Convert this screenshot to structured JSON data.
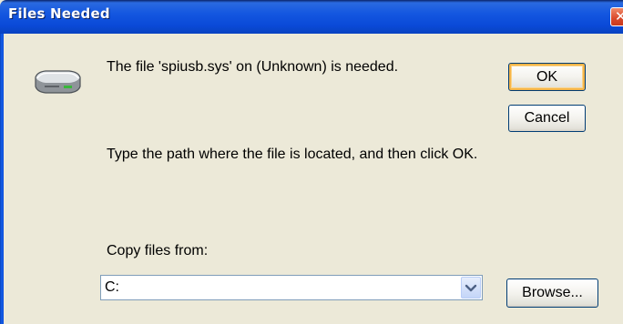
{
  "window": {
    "title": "Files Needed"
  },
  "titlebar": {
    "close_glyph": "✕"
  },
  "message": {
    "text": "The file 'spiusb.sys' on (Unknown) is needed."
  },
  "instruction": {
    "text": "Type the path where the file is located, and then click OK."
  },
  "copy_from": {
    "label": "Copy files from:",
    "value": "C:"
  },
  "buttons": {
    "ok": "OK",
    "cancel": "Cancel",
    "browse": "Browse..."
  },
  "icons": {
    "drive": "hard-drive-icon",
    "dropdown": "chevron-down-icon",
    "close": "close-icon"
  },
  "colors": {
    "titlebar": "#0a4ad8",
    "close_button": "#d9482a",
    "dialog_bg": "#ece9d8",
    "default_button_focus": "#f5b548"
  }
}
